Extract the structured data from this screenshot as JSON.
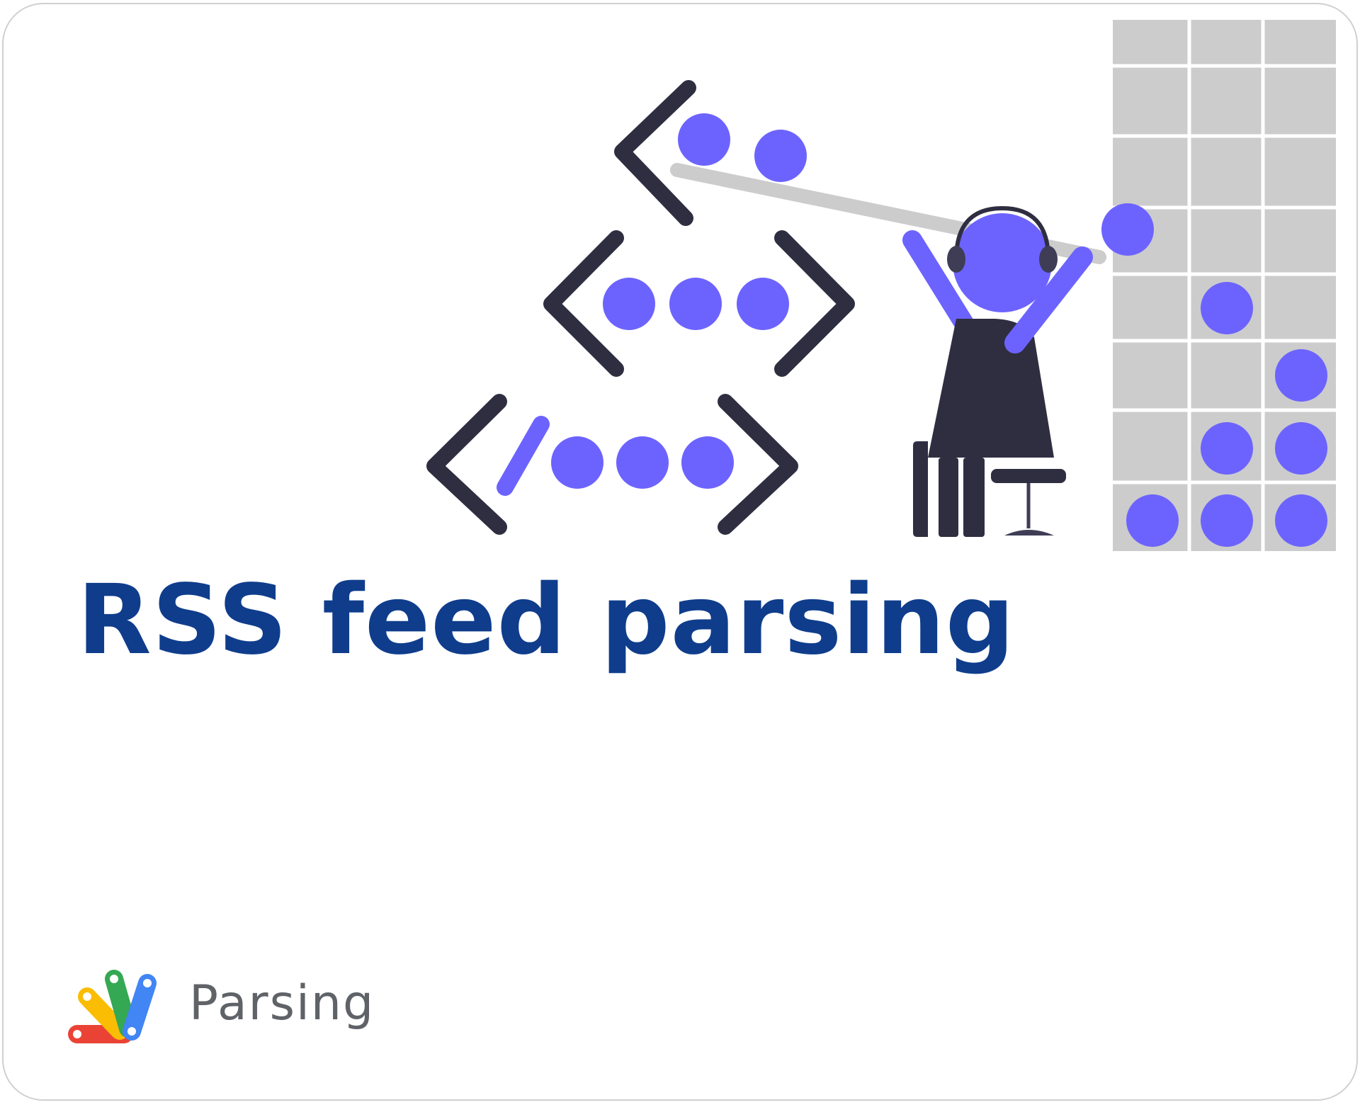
{
  "title": "RSS feed parsing",
  "category": "Parsing",
  "icons": {
    "illustration": "coder-with-headphones-and-code-tags",
    "logo": "apps-script-logo-icon"
  },
  "colors": {
    "title": "#0f3d8c",
    "category": "#5f6368",
    "accent": "#6c63ff",
    "dark": "#2f2e41",
    "grid": "#cccccc"
  }
}
